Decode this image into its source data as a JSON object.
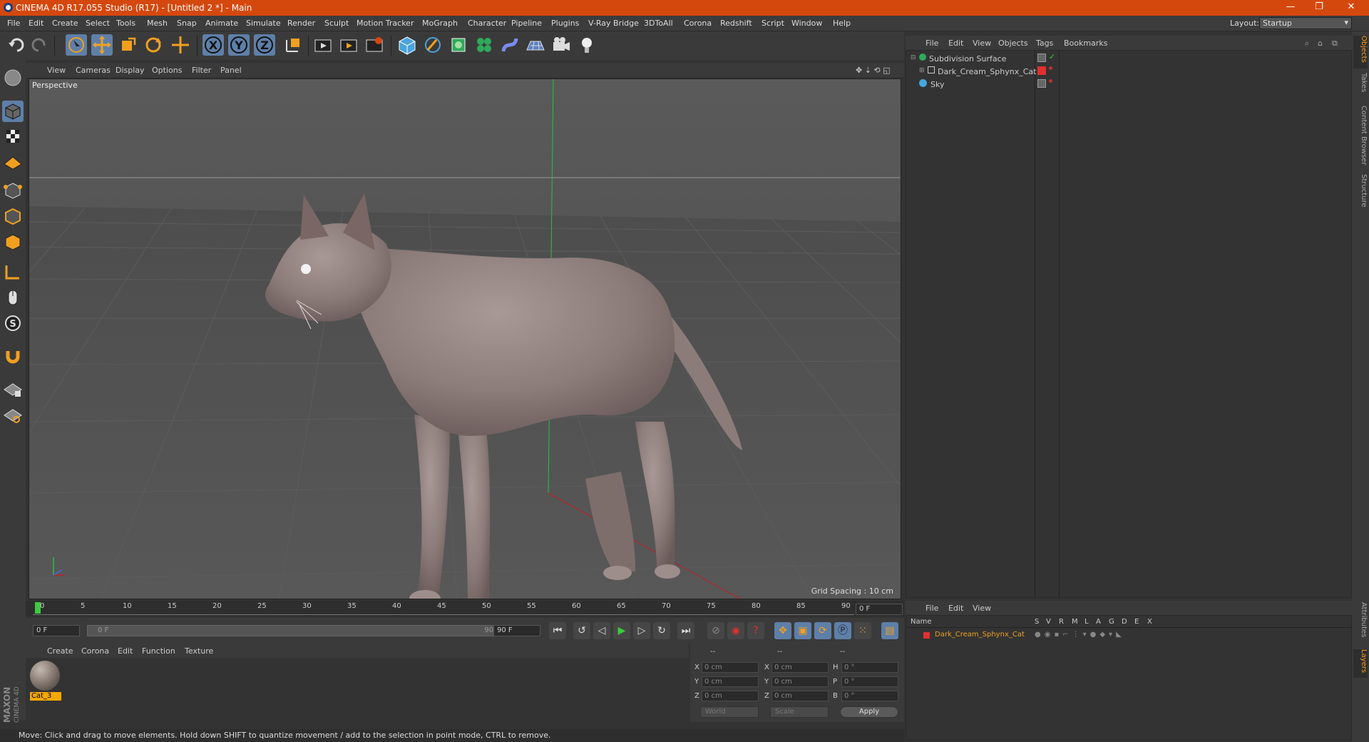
{
  "titlebar": {
    "title": "CINEMA 4D R17.055 Studio (R17) - [Untitled 2 *] - Main",
    "minimize": "—",
    "restore": "❐",
    "close": "✕"
  },
  "menubar": {
    "items": [
      "File",
      "Edit",
      "Create",
      "Select",
      "Tools",
      "Mesh",
      "Snap",
      "Animate",
      "Simulate",
      "Render",
      "Sculpt",
      "Motion Tracker",
      "MoGraph",
      "Character",
      "Pipeline",
      "Plugins",
      "V-Ray Bridge",
      "3DToAll",
      "Corona",
      "Redshift",
      "Script",
      "Window",
      "Help"
    ],
    "layout_label": "Layout:",
    "layout_value": "Startup"
  },
  "viewport": {
    "menu": [
      "View",
      "Cameras",
      "Display",
      "Options",
      "Filter",
      "Panel"
    ],
    "label": "Perspective",
    "grid_spacing": "Grid Spacing : 10 cm"
  },
  "timeline": {
    "ticks": [
      "0",
      "5",
      "10",
      "15",
      "20",
      "25",
      "30",
      "35",
      "40",
      "45",
      "50",
      "55",
      "60",
      "65",
      "70",
      "75",
      "80",
      "85",
      "90"
    ],
    "current_frame": "0 F",
    "start_field": "0 F",
    "range_start": "0 F",
    "range_end": "90 F",
    "end_field": "90 F"
  },
  "material_manager": {
    "menu": [
      "Create",
      "Corona",
      "Edit",
      "Function",
      "Texture"
    ],
    "material_name": "Cat_3"
  },
  "coordinates": {
    "header": [
      "--",
      "--",
      "--"
    ],
    "rows": [
      {
        "l1": "X",
        "v1": "0 cm",
        "l2": "X",
        "v2": "0 cm",
        "l3": "H",
        "v3": "0 °"
      },
      {
        "l1": "Y",
        "v1": "0 cm",
        "l2": "Y",
        "v2": "0 cm",
        "l3": "P",
        "v3": "0 °"
      },
      {
        "l1": "Z",
        "v1": "0 cm",
        "l2": "Z",
        "v2": "0 cm",
        "l3": "B",
        "v3": "0 °"
      }
    ],
    "mode1": "World",
    "mode2": "Scale",
    "apply": "Apply"
  },
  "statusbar": {
    "text": "Move: Click and drag to move elements. Hold down SHIFT to quantize movement / add to the selection in point mode, CTRL to remove."
  },
  "object_manager": {
    "menu": [
      "File",
      "Edit",
      "View",
      "Objects",
      "Tags",
      "Bookmarks"
    ],
    "objects": [
      "Subdivision Surface",
      "Dark_Cream_Sphynx_Cat",
      "Sky"
    ]
  },
  "layer_manager": {
    "menu": [
      "File",
      "Edit",
      "View"
    ],
    "headers": [
      "Name",
      "S",
      "V",
      "R",
      "M",
      "L",
      "A",
      "G",
      "D",
      "E",
      "X"
    ],
    "layer_name": "Dark_Cream_Sphynx_Cat"
  },
  "side_tabs": [
    "Objects",
    "Takes",
    "Content Browser",
    "Structure",
    "Attributes",
    "Layers"
  ],
  "brand": {
    "line1": "MAXON",
    "line2": "CINEMA 4D"
  },
  "colors": {
    "title_bar": "#d4480e",
    "accent": "#f0a020",
    "selected_tool": "#5e7fa8",
    "layer_red": "#e03030"
  }
}
